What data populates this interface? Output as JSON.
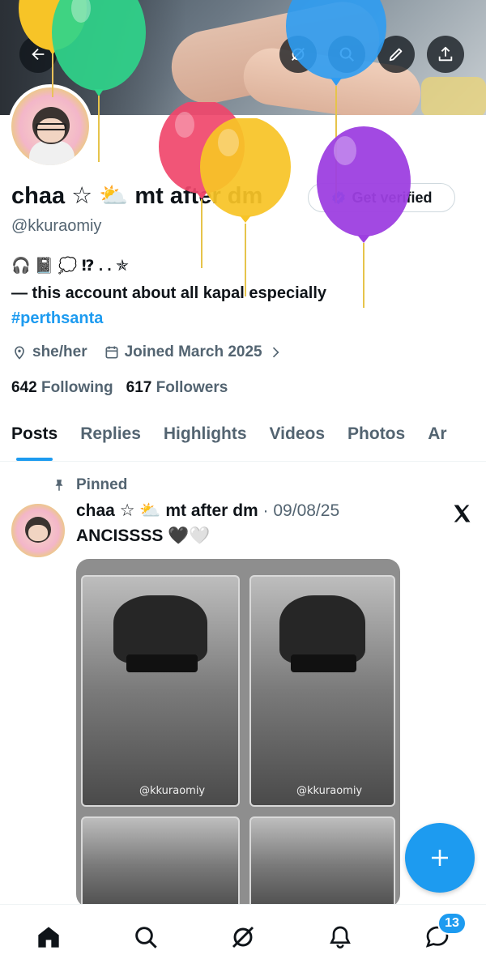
{
  "profile": {
    "name": "chaa ☆ ⛅ mt after dm",
    "handle": "@kkuraomiy",
    "verify_label": "Get verified",
    "bio_line1": "🎧 📓 💭 ⁉ . . ✯",
    "bio_line2": "— this account about all kapal especially",
    "bio_hashtag": "#perthsanta",
    "pronouns": "she/her",
    "joined": "Joined March 2025",
    "following_count": "642",
    "following_label": "Following",
    "followers_count": "617",
    "followers_label": "Followers"
  },
  "top_bar": {
    "back_icon": "arrow-left-icon",
    "grok_icon": "grok-icon",
    "search_icon": "search-icon",
    "edit_icon": "pen-icon",
    "share_icon": "share-icon"
  },
  "tabs": [
    "Posts",
    "Replies",
    "Highlights",
    "Videos",
    "Photos",
    "Ar"
  ],
  "active_tab": "Posts",
  "post": {
    "pinned_label": "Pinned",
    "author": "chaa ☆ ⛅ mt after dm",
    "date": "· 09/08/25",
    "text": "ANCISSSS 🖤🤍",
    "watermark1": "@kkuraomiy",
    "watermark2": "@kkuraomiy"
  },
  "bottom_nav": {
    "items": [
      "home-icon",
      "search-icon",
      "grok-icon",
      "bell-icon",
      "messages-icon"
    ],
    "messages_badge": "13"
  },
  "colors": {
    "accent": "#1d9bf0",
    "text_primary": "#0f1419",
    "text_secondary": "#536471"
  }
}
